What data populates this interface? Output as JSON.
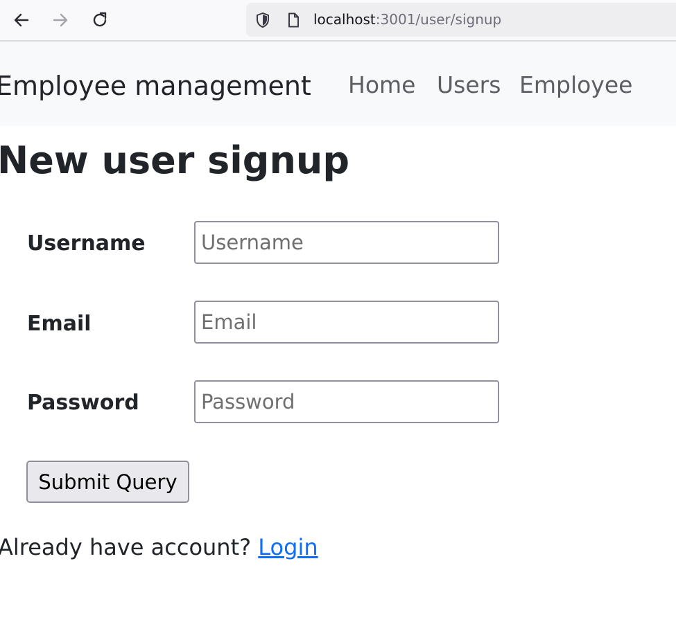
{
  "browser": {
    "back_icon": "arrow-left-icon",
    "forward_icon": "arrow-right-icon",
    "reload_icon": "reload-icon",
    "shield_icon": "shield-icon",
    "page_icon": "page-icon",
    "url_host": "localhost",
    "url_rest": ":3001/user/signup"
  },
  "navbar": {
    "brand": "Employee management",
    "links": [
      {
        "label": "Home"
      },
      {
        "label": "Users"
      },
      {
        "label": "Employee"
      }
    ]
  },
  "page": {
    "title": "New user signup"
  },
  "form": {
    "username": {
      "label": "Username",
      "placeholder": "Username",
      "value": ""
    },
    "email": {
      "label": "Email",
      "placeholder": "Email",
      "value": ""
    },
    "password": {
      "label": "Password",
      "placeholder": "Password",
      "value": ""
    },
    "submit_label": "Submit Query"
  },
  "footer": {
    "prompt": "Already have account? ",
    "login_label": "Login"
  },
  "colors": {
    "link": "#0d6efd",
    "navbar_bg": "#f8f9fa",
    "text": "#212529",
    "nav_link": "#5b5f63"
  }
}
